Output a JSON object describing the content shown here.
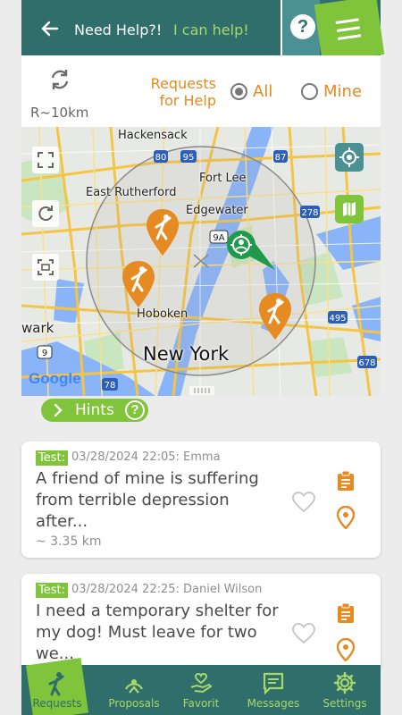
{
  "header": {
    "title": "Need Help?!",
    "subtitle": "I can help!",
    "help_symbol": "?"
  },
  "filter": {
    "radius": "R~10km",
    "label": "Requests for Help",
    "options": [
      {
        "label": "All",
        "selected": true
      },
      {
        "label": "Mine",
        "selected": false
      }
    ]
  },
  "map": {
    "labels": [
      "Hackensack",
      "East Rutherford",
      "Fort Lee",
      "Edgewater",
      "Hoboken",
      "New York",
      "wark"
    ],
    "route_badges": [
      "80",
      "95",
      "87",
      "278",
      "9A",
      "495",
      "9",
      "78",
      "678"
    ],
    "attribution": "Google"
  },
  "hints": {
    "label": "Hints",
    "help_symbol": "?"
  },
  "requests": [
    {
      "tag": "Test:",
      "meta": "03/28/2024 22:05: Emma",
      "text": "A friend of mine is suffering from terrible depression after...",
      "distance": "~ 3.35 km"
    },
    {
      "tag": "Test:",
      "meta": "03/28/2024 22:25: Daniel Wilson",
      "text": "I need a temporary shelter for my dog! Must leave for two we..."
    }
  ],
  "nav": [
    {
      "label": "Requests",
      "icon": "person-icon",
      "active": true
    },
    {
      "label": "Proposals",
      "icon": "helping-icon",
      "active": false
    },
    {
      "label": "Favorit",
      "icon": "heart-hand-icon",
      "active": false
    },
    {
      "label": "Messages",
      "icon": "message-icon",
      "active": false
    },
    {
      "label": "Settings",
      "icon": "gear-icon",
      "active": false
    }
  ],
  "colors": {
    "primary": "#2f6e6b",
    "accent_green": "#7fc43a",
    "accent_orange": "#e68a22",
    "teal": "#4b9093"
  }
}
